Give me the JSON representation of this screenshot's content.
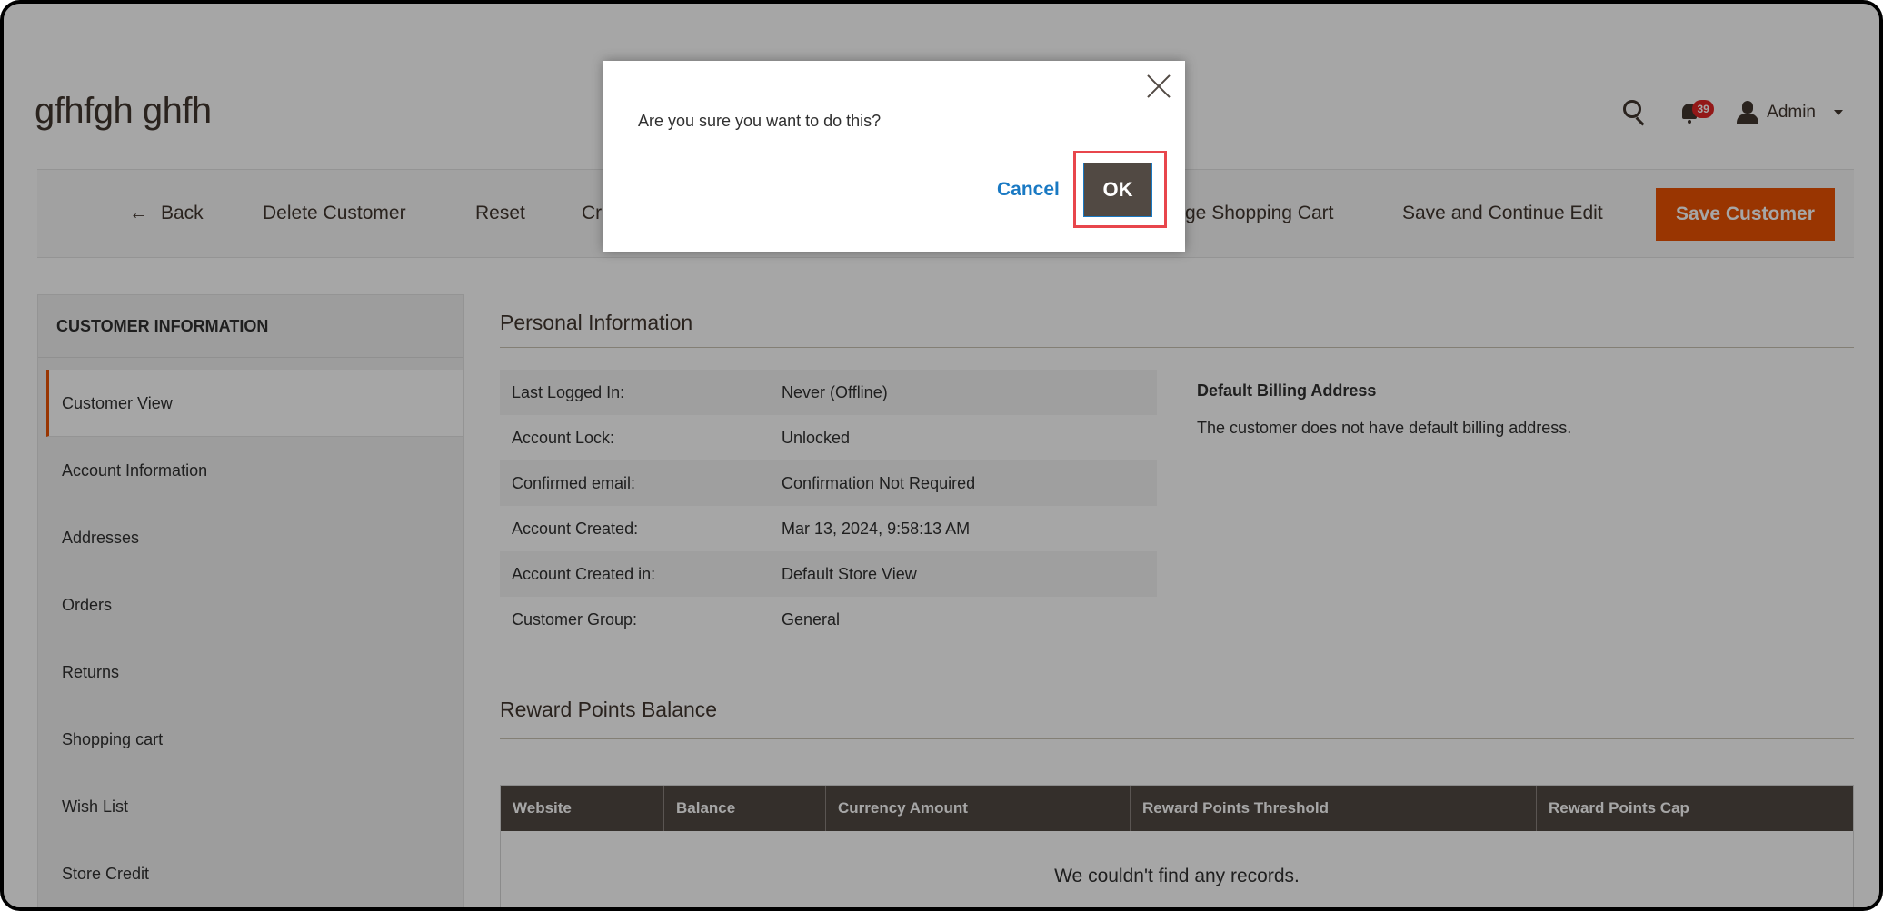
{
  "page": {
    "title": "gfhfgh ghfh"
  },
  "header": {
    "notifications_count": "39",
    "user_name": "Admin"
  },
  "toolbar": {
    "back_label": "Back",
    "delete_label": "Delete Customer",
    "reset_label": "Reset",
    "create_order_label_visible": "Cr",
    "manage_cart_label_visible": "ge Shopping Cart",
    "save_continue_label": "Save and Continue Edit",
    "save_label": "Save Customer"
  },
  "sidebar": {
    "title": "CUSTOMER INFORMATION",
    "items": [
      {
        "label": "Customer View",
        "active": true
      },
      {
        "label": "Account Information"
      },
      {
        "label": "Addresses"
      },
      {
        "label": "Orders"
      },
      {
        "label": "Returns"
      },
      {
        "label": "Shopping cart"
      },
      {
        "label": "Wish List"
      },
      {
        "label": "Store Credit"
      }
    ]
  },
  "personal_info": {
    "title": "Personal Information",
    "rows": [
      {
        "label": "Last Logged In:",
        "value": "Never (Offline)"
      },
      {
        "label": "Account Lock:",
        "value": "Unlocked"
      },
      {
        "label": "Confirmed email:",
        "value": "Confirmation Not Required"
      },
      {
        "label": "Account Created:",
        "value": "Mar 13, 2024, 9:58:13 AM"
      },
      {
        "label": "Account Created in:",
        "value": "Default Store View"
      },
      {
        "label": "Customer Group:",
        "value": "General"
      }
    ],
    "billing_title": "Default Billing Address",
    "billing_text": "The customer does not have default billing address."
  },
  "reward_points": {
    "title": "Reward Points Balance",
    "columns": [
      "Website",
      "Balance",
      "Currency Amount",
      "Reward Points Threshold",
      "Reward Points Cap"
    ],
    "empty_message": "We couldn't find any records."
  },
  "modal": {
    "message": "Are you sure you want to do this?",
    "cancel_label": "Cancel",
    "ok_label": "OK"
  },
  "colors": {
    "accent": "#eb5202",
    "link": "#1979c3",
    "grid_header": "#514943",
    "highlight": "#e8464c",
    "badge": "#e22626"
  }
}
